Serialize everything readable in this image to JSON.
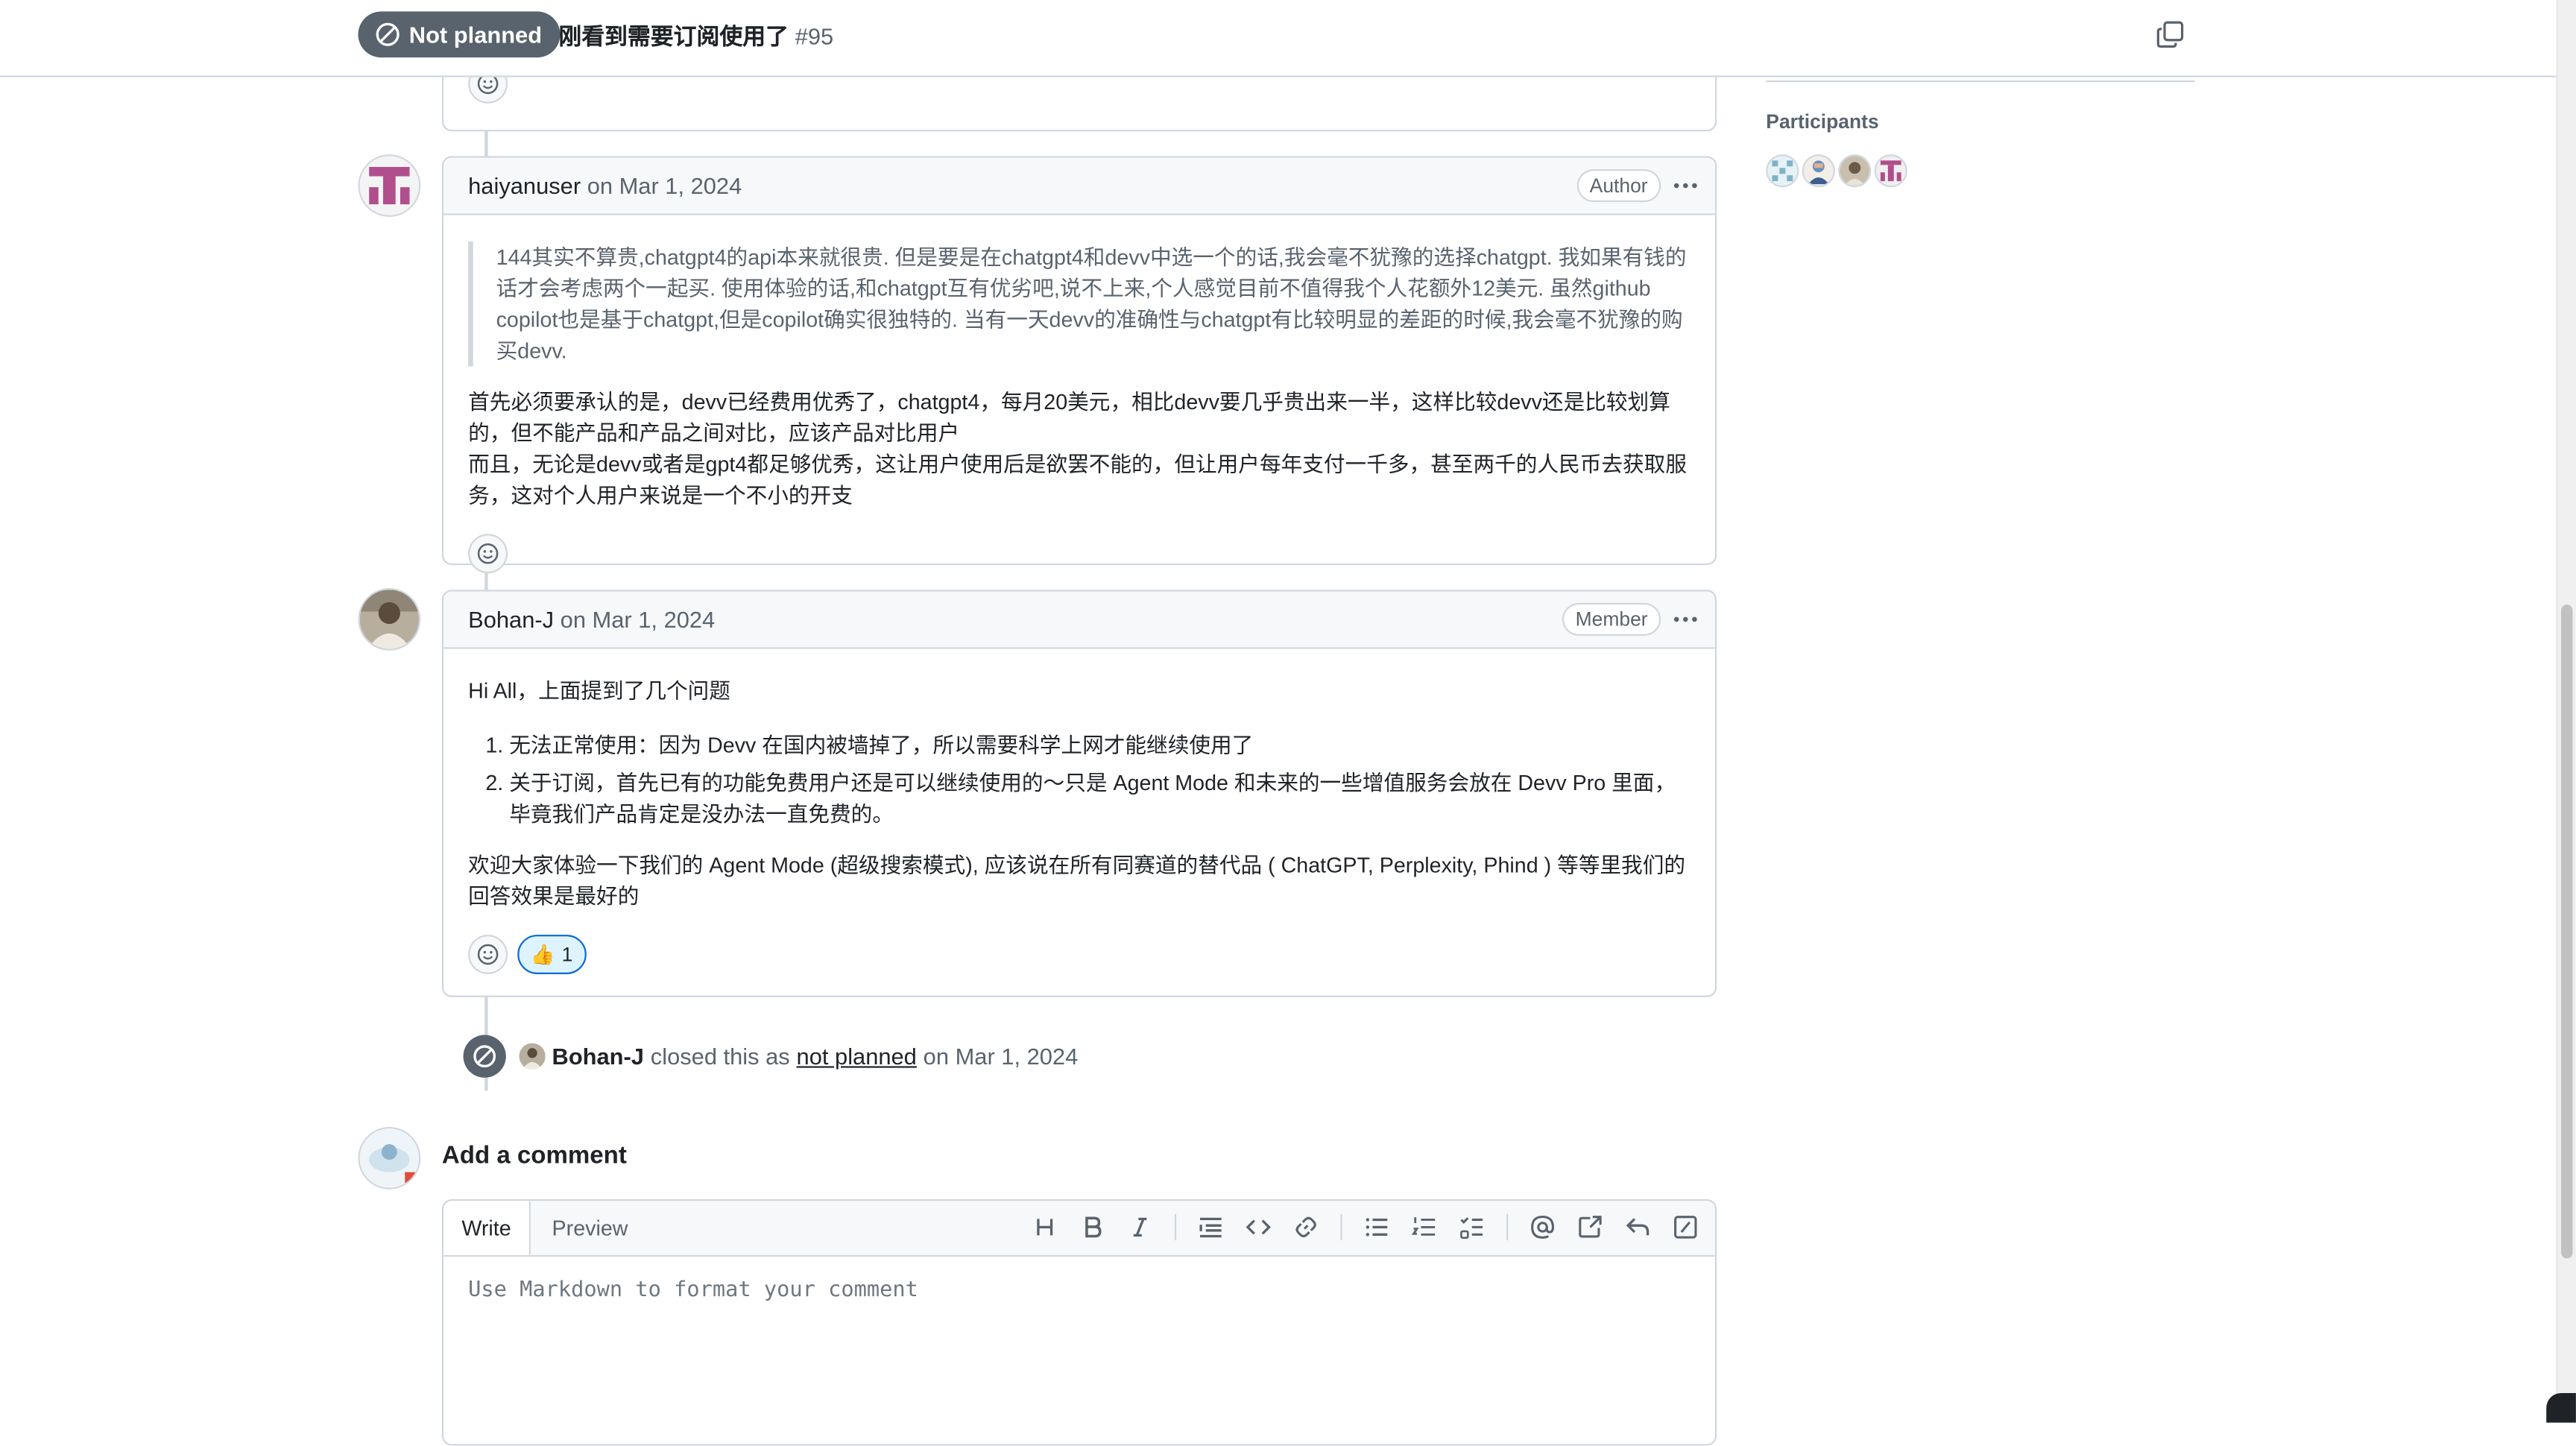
{
  "header": {
    "state_label": "Not planned",
    "issue_title": "刚看到需要订阅使用了",
    "issue_number": "#95"
  },
  "sidebar": {
    "participants_heading": "Participants"
  },
  "comments": [
    {
      "author": "haiyanuser",
      "date": "on Mar 1, 2024",
      "badge": "Author",
      "quote": "144其实不算贵,chatgpt4的api本来就很贵. 但是要是在chatgpt4和devv中选一个的话,我会毫不犹豫的选择chatgpt. 我如果有钱的话才会考虑两个一起买. 使用体验的话,和chatgpt互有优劣吧,说不上来,个人感觉目前不值得我个人花额外12美元. 虽然github copilot也是基于chatgpt,但是copilot确实很独特的. 当有一天devv的准确性与chatgpt有比较明显的差距的时候,我会毫不犹豫的购买devv.",
      "para1_line1": "首先必须要承认的是，devv已经费用优秀了，chatgpt4，每月20美元，相比devv要几乎贵出来一半，这样比较devv还是比较划算的，但不能产品和产品之间对比，应该产品对比用户",
      "para1_line2": "而且，无论是devv或者是gpt4都足够优秀，这让用户使用后是欲罢不能的，但让用户每年支付一千多，甚至两千的人民币去获取服务，这对个人用户来说是一个不小的开支"
    },
    {
      "author": "Bohan-J",
      "date": "on Mar 1, 2024",
      "badge": "Member",
      "intro": "Hi All，上面提到了几个问题",
      "list": [
        "无法正常使用：因为 Devv 在国内被墙掉了，所以需要科学上网才能继续使用了",
        "关于订阅，首先已有的功能免费用户还是可以继续使用的～只是 Agent Mode 和未来的一些增值服务会放在 Devv Pro 里面，毕竟我们产品肯定是没办法一直免费的。"
      ],
      "closing": "欢迎大家体验一下我们的 Agent Mode (超级搜索模式), 应该说在所有同赛道的替代品 ( ChatGPT, Perplexity, Phind ) 等等里我们的回答效果是最好的",
      "reaction_emoji": "👍",
      "reaction_count": "1"
    }
  ],
  "event": {
    "actor": "Bohan-J",
    "text_before": "closed this as",
    "link_text": "not planned",
    "text_after": "on Mar 1, 2024"
  },
  "compose": {
    "title": "Add a comment",
    "tab_write": "Write",
    "tab_preview": "Preview",
    "placeholder": "Use Markdown to format your comment"
  }
}
